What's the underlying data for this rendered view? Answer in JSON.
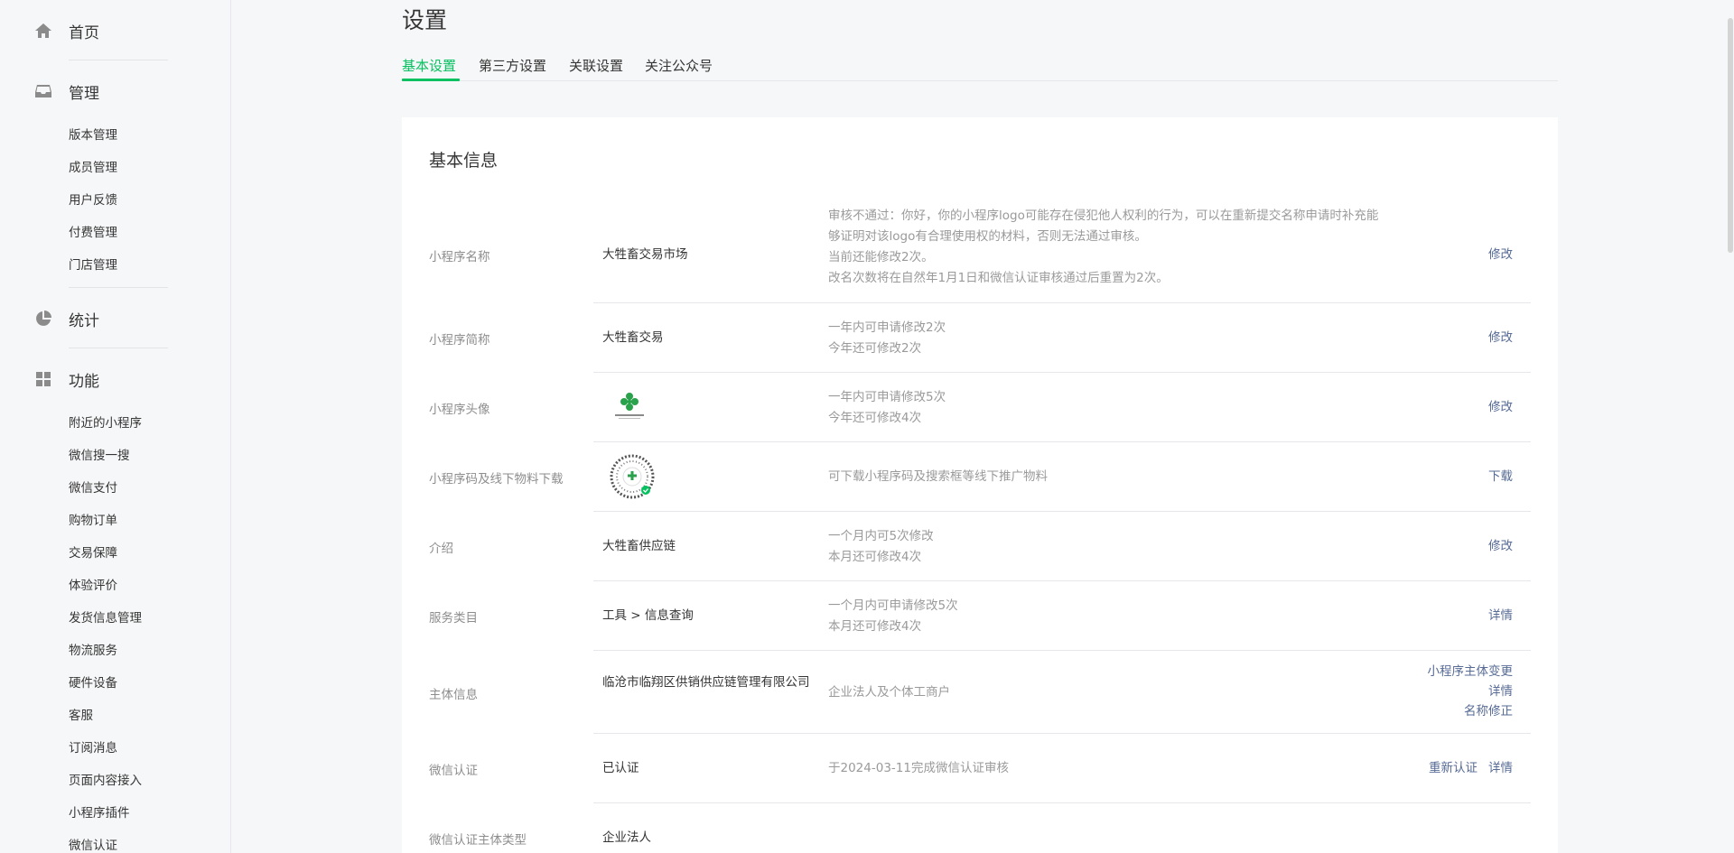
{
  "sidebar": {
    "home": {
      "label": "首页",
      "icon": "home-icon"
    },
    "manage": {
      "label": "管理",
      "icon": "inbox-icon",
      "items": [
        "版本管理",
        "成员管理",
        "用户反馈",
        "付费管理",
        "门店管理"
      ]
    },
    "stats": {
      "label": "统计",
      "icon": "pie-chart-icon"
    },
    "features": {
      "label": "功能",
      "icon": "grid-icon",
      "items": [
        "附近的小程序",
        "微信搜一搜",
        "微信支付",
        "购物订单",
        "交易保障",
        "体验评价",
        "发货信息管理",
        "物流服务",
        "硬件设备",
        "客服",
        "订阅消息",
        "页面内容接入",
        "小程序插件",
        "微信认证"
      ]
    }
  },
  "page": {
    "title": "设置"
  },
  "tabs": [
    "基本设置",
    "第三方设置",
    "关联设置",
    "关注公众号"
  ],
  "card": {
    "title": "基本信息"
  },
  "rows": [
    {
      "label": "小程序名称",
      "value": "大牲畜交易市场",
      "desc": [
        "审核不通过：你好，你的小程序logo可能存在侵犯他人权利的行为，可以在重新提交名称申请时补充能",
        "够证明对该logo有合理使用权的材料，否则无法通过审核。",
        "当前还能修改2次。",
        "改名次数将在自然年1月1日和微信认证审核通过后重置为2次。"
      ],
      "actions": [
        "修改"
      ]
    },
    {
      "label": "小程序简称",
      "value": "大牲畜交易",
      "desc": [
        "一年内可申请修改2次",
        "今年还可修改2次"
      ],
      "actions": [
        "修改"
      ]
    },
    {
      "label": "小程序头像",
      "value": "",
      "desc": [
        "一年内可申请修改5次",
        "今年还可修改4次"
      ],
      "actions": [
        "修改"
      ]
    },
    {
      "label": "小程序码及线下物料下载",
      "value": "",
      "desc": [
        "可下载小程序码及搜索框等线下推广物料"
      ],
      "actions": [
        "下载"
      ]
    },
    {
      "label": "介绍",
      "value": "大牲畜供应链",
      "desc": [
        "一个月内可5次修改",
        "本月还可修改4次"
      ],
      "actions": [
        "修改"
      ]
    },
    {
      "label": "服务类目",
      "value": "工具 > 信息查询",
      "desc": [
        "一个月内可申请修改5次",
        "本月还可修改4次"
      ],
      "actions": [
        "详情"
      ]
    },
    {
      "label": "主体信息",
      "value": "临沧市临翔区供销供应链管理有限公司",
      "desc": [
        "企业法人及个体工商户"
      ],
      "actions": [
        "小程序主体变更",
        "详情",
        "名称修正"
      ]
    },
    {
      "label": "微信认证",
      "value": "已认证",
      "desc": [
        "于2024-03-11完成微信认证审核"
      ],
      "actions": [
        "重新认证",
        "详情"
      ]
    },
    {
      "label": "微信认证主体类型",
      "value": "企业法人",
      "desc": [],
      "actions": []
    }
  ],
  "colors": {
    "accent": "#07c160",
    "link": "#576b95",
    "muted": "#8d8d8d"
  }
}
